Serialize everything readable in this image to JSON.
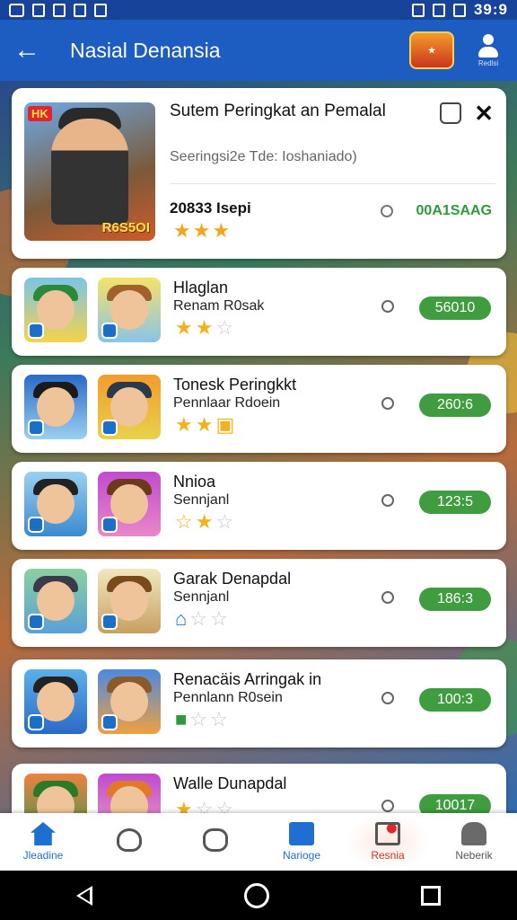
{
  "status_bar": {
    "time": "39:9"
  },
  "app_bar": {
    "title": "Nasial Denansia",
    "back_icon": "arrow-left-icon",
    "badge_icon": "game-badge-icon",
    "profile_icon": "person-icon",
    "profile_label": "Redlsi"
  },
  "featured": {
    "thumb_tag": "HK",
    "thumb_score": "R6S5OI",
    "title": "Sutem Peringkat an Pemalal",
    "subtitle": "Seeringsi2e  Tde: Ioshaniado)",
    "name": "20833 Isepi",
    "stars": "★★★",
    "points": "00A1SAAG"
  },
  "rows": [
    {
      "title": "Hlaglan",
      "subtitle": "Renam R0sak",
      "stars_on": "★★",
      "stars_off": "☆",
      "points": "56010"
    },
    {
      "title": "Tonesk Peringkkt",
      "subtitle": "Pennlaar Rdoein",
      "stars_on": "★★",
      "stars_off": "▣",
      "points": "260:6"
    },
    {
      "title": "Nnioa",
      "subtitle": "Sennjanl",
      "stars_on": "☆★",
      "stars_off": "☆",
      "points": "123:5"
    },
    {
      "title": "Garak Denapdal",
      "subtitle": "Sennjanl",
      "stars_on": "⌂",
      "stars_off": "☆☆",
      "points": "186:3"
    },
    {
      "title": "Renacäis Arringak in",
      "subtitle": "Pennlann R0sein",
      "stars_on": "■",
      "stars_off": "☆☆",
      "points": "100:3"
    },
    {
      "title": "Walle Dunapdal",
      "subtitle": "",
      "stars_on": "★",
      "stars_off": "☆☆",
      "points": "10017"
    }
  ],
  "bottom_nav": [
    {
      "label": "Jleadine",
      "icon": "home-icon"
    },
    {
      "label": "",
      "icon": "heart-icon"
    },
    {
      "label": "",
      "icon": "pet-icon"
    },
    {
      "label": "Narioge",
      "icon": "gift-icon"
    },
    {
      "label": "Resnia",
      "icon": "ranking-icon"
    },
    {
      "label": "Neberik",
      "icon": "person-icon"
    }
  ],
  "colors": {
    "appbar": "#1d5cc0",
    "accent_green": "#3f9d3f",
    "star": "#f3b11b"
  }
}
